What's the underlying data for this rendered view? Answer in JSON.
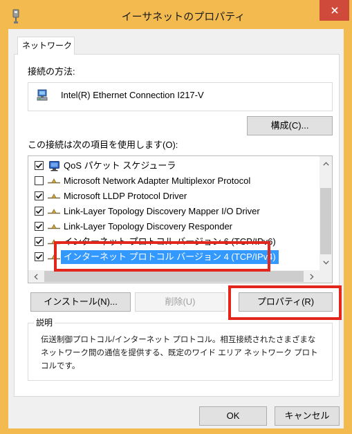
{
  "window": {
    "title": "イーサネットのプロパティ",
    "title_icon": "network-adapter-icon",
    "close_icon": "close-icon",
    "frame_color": "#F3BB4F",
    "close_button_color": "#CF4A3B"
  },
  "tabs": [
    {
      "label": "ネットワーク",
      "active": true
    }
  ],
  "connection": {
    "label": "接続の方法:",
    "adapter_icon": "network-adapter-icon",
    "adapter_name": "Intel(R) Ethernet Connection I217-V",
    "configure_button": "構成(C)..."
  },
  "components": {
    "label": "この接続は次の項目を使用します(O):",
    "items": [
      {
        "label": "QoS パケット スケジューラ",
        "icon": "qos-scheduler-icon",
        "checked": true,
        "selected": false
      },
      {
        "label": "Microsoft Network Adapter Multiplexor Protocol",
        "icon": "protocol-icon",
        "checked": false,
        "selected": false
      },
      {
        "label": "Microsoft LLDP Protocol Driver",
        "icon": "protocol-icon",
        "checked": true,
        "selected": false
      },
      {
        "label": "Link-Layer Topology Discovery Mapper I/O Driver",
        "icon": "protocol-icon",
        "checked": true,
        "selected": false
      },
      {
        "label": "Link-Layer Topology Discovery Responder",
        "icon": "protocol-icon",
        "checked": true,
        "selected": false
      },
      {
        "label": "インターネット プロトコル バージョン 6 (TCP/IPv6)",
        "icon": "protocol-icon",
        "checked": true,
        "selected": false
      },
      {
        "label": "インターネット プロトコル バージョン 4 (TCP/IPv4)",
        "icon": "protocol-icon",
        "checked": true,
        "selected": true,
        "annotated": true
      }
    ],
    "scrollbar_icons": [
      "chevron-up-icon",
      "chevron-down-icon",
      "chevron-left-icon",
      "chevron-right-icon"
    ],
    "buttons": {
      "install": {
        "label": "インストール(N)...",
        "enabled": true
      },
      "uninstall": {
        "label": "削除(U)",
        "enabled": false
      },
      "properties": {
        "label": "プロパティ(R)",
        "enabled": true,
        "annotated": true
      }
    }
  },
  "description": {
    "label": "説明",
    "lines": [
      "伝送制御プロトコル/インターネット プロトコル。相互接続されたさまざまな",
      "ネットワーク間の通信を提供する、既定のワイド エリア ネットワーク プロト",
      "コルです。"
    ]
  },
  "footer": {
    "ok_button": "OK",
    "cancel_button": "キャンセル"
  },
  "annotations": {
    "color": "#E3261C"
  },
  "colors": {
    "client_background": "#F0F0F0",
    "panel_background": "#FFFFFF",
    "selection": "#3399FF"
  }
}
